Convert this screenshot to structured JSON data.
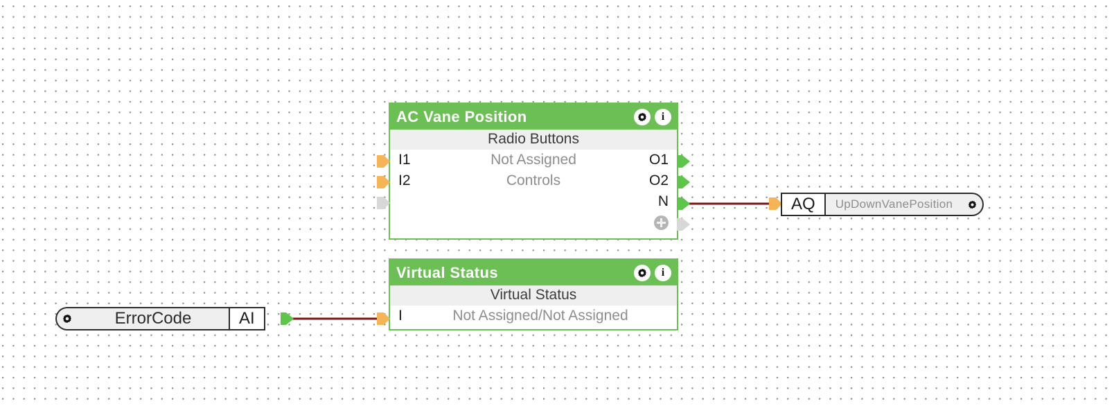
{
  "canvas": {
    "grid": "dotted",
    "background_color": "#ffffff",
    "dot_color": "#8a8d90"
  },
  "theme": {
    "block_green": "#6cbf55",
    "header_text": "#ffffff",
    "subtitle_bg": "#efefef",
    "muted_text": "#8d8d8d",
    "wire_color": "#7a1410",
    "input_port_color": "#f5b457",
    "output_port_color": "#5ec44a",
    "disabled_port_color": "#d8d8d8"
  },
  "blocks": [
    {
      "id": "ac-vane-position",
      "title": "AC Vane Position",
      "subtitle": "Radio Buttons",
      "header_icons": [
        "gear-icon",
        "info-icon"
      ],
      "rows": [
        {
          "input": "I1",
          "middle": "Not Assigned",
          "output": "O1"
        },
        {
          "input": "I2",
          "middle": "Controls",
          "output": "O2"
        },
        {
          "input": "add",
          "middle": "",
          "output": "N"
        },
        {
          "input": "",
          "middle": "",
          "output": "add"
        }
      ]
    },
    {
      "id": "virtual-status",
      "title": "Virtual Status",
      "subtitle": "Virtual Status",
      "header_icons": [
        "gear-icon",
        "info-icon"
      ],
      "rows": [
        {
          "input": "I",
          "middle": "Not Assigned/Not Assigned",
          "output": ""
        }
      ]
    }
  ],
  "variables": [
    {
      "id": "up-down-vane-position",
      "type": "AQ",
      "name": "UpDownVanePosition",
      "gear": "gear-icon",
      "gear_side": "right"
    },
    {
      "id": "error-code",
      "type": "AI",
      "name": "ErrorCode",
      "gear": "gear-icon",
      "gear_side": "left"
    }
  ],
  "connections": [
    {
      "from": "ac-vane-position.N",
      "to": "up-down-vane-position.AQ"
    },
    {
      "from": "error-code.AI",
      "to": "virtual-status.I"
    }
  ]
}
